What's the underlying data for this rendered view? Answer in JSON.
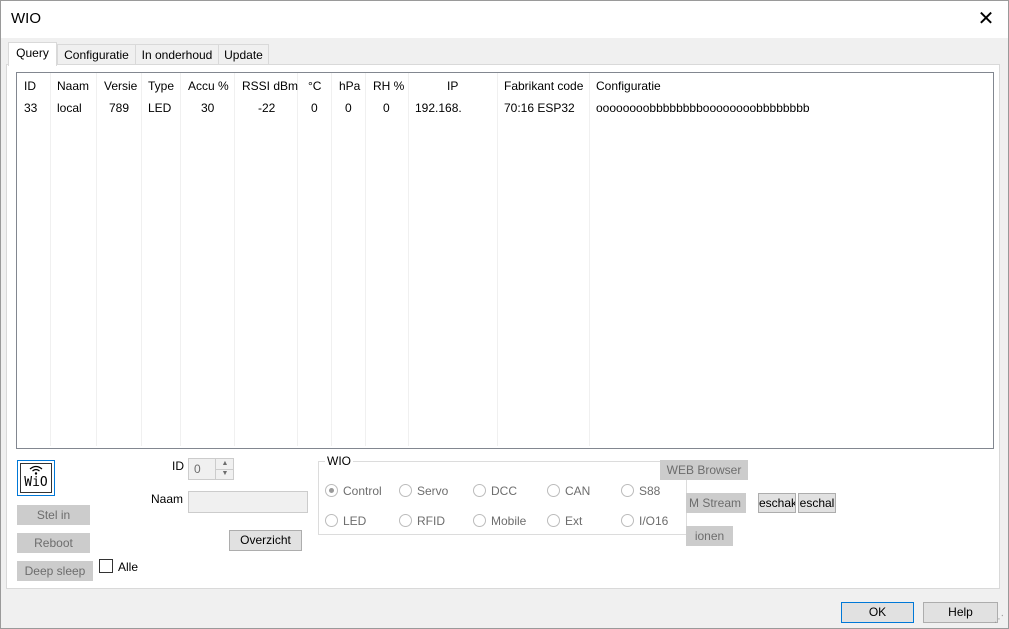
{
  "window": {
    "title": "WIO",
    "close_glyph": "✕"
  },
  "tabs": [
    "Query",
    "Configuratie",
    "In onderhoud",
    "Update"
  ],
  "table": {
    "columns": [
      "ID",
      "Naam",
      "Versie",
      "Type",
      "Accu %",
      "RSSI dBm",
      "°C",
      "hPa",
      "RH %",
      "IP",
      "Fabrikant code",
      "Configuratie"
    ],
    "rows": [
      [
        "33",
        "local",
        "789",
        "LED",
        "30",
        "-22",
        "0",
        "0",
        "0",
        "192.168.",
        "70:16 ESP32",
        "oooooooobbbbbbbboooooooobbbbbbbb"
      ]
    ]
  },
  "logo": {
    "icon": "wifi-icon",
    "text": "WiO"
  },
  "buttons": {
    "stel_in": "Stel in",
    "reboot": "Reboot",
    "deep_sleep": "Deep sleep",
    "overzicht": "Overzicht",
    "web_browser": "WEB Browser",
    "stream": "M Stream",
    "eschak1": "eschak",
    "eschak2": "eschal",
    "ionen": "ionen",
    "ok": "OK",
    "help": "Help"
  },
  "alle": {
    "label": "Alle",
    "checked": false
  },
  "id_field": {
    "label": "ID",
    "value": "0"
  },
  "naam_field": {
    "label": "Naam",
    "value": ""
  },
  "wio_group": {
    "title": "WIO",
    "options": [
      "Control",
      "Servo",
      "DCC",
      "CAN",
      "S88",
      "LED",
      "RFID",
      "Mobile",
      "Ext",
      "I/O16"
    ],
    "selected": "Control"
  }
}
